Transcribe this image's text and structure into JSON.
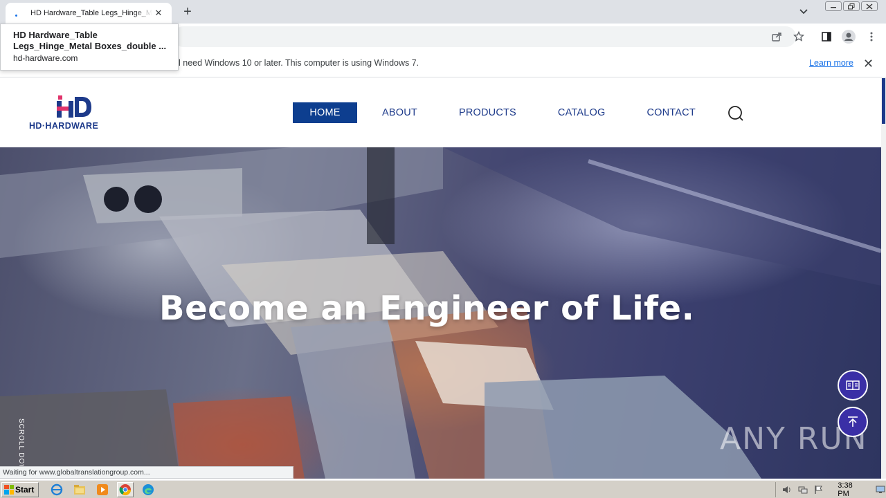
{
  "browser": {
    "tab_title": "HD Hardware_Table Legs_Hinge_Metal Boxes_double layer",
    "tooltip": {
      "title": "HD Hardware_Table Legs_Hinge_Metal Boxes_double ...",
      "url": "hd-hardware.com"
    },
    "infobar": {
      "message": "l need Windows 10 or later. This computer is using Windows 7.",
      "link": "Learn more"
    },
    "status": "Waiting for www.globaltranslationgroup.com..."
  },
  "site": {
    "logo_text": "HD·HARDWARE",
    "nav": [
      {
        "label": "HOME",
        "active": true
      },
      {
        "label": "ABOUT"
      },
      {
        "label": "PRODUCTS"
      },
      {
        "label": "CATALOG"
      },
      {
        "label": "CONTACT"
      }
    ],
    "hero": {
      "headline": "Become an Engineer of Life.",
      "scroll_label": "SCROLL DOWN"
    },
    "watermark": "ANY RUN"
  },
  "taskbar": {
    "start_label": "Start",
    "clock": "3:38 PM"
  },
  "colors": {
    "brand": "#1d3a8a",
    "nav_active": "#0d3e8f",
    "float_button": "#3a2fa6",
    "logo_pink": "#e0336b"
  }
}
